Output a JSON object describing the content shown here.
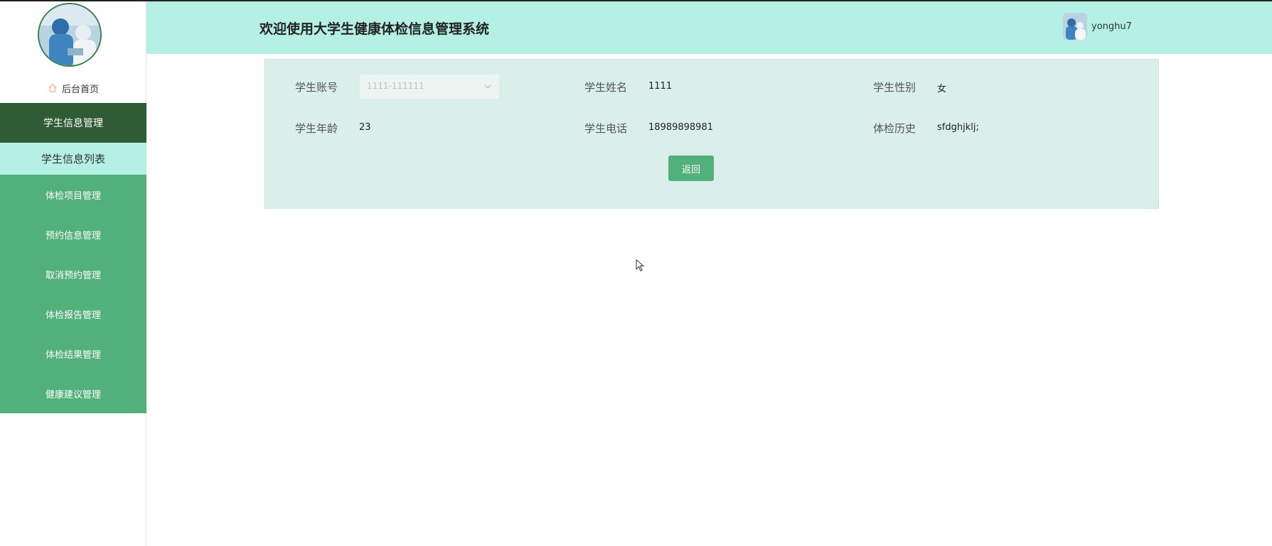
{
  "header": {
    "title": "欢迎使用大学生健康体检信息管理系统",
    "username": "yonghu7"
  },
  "sidebar": {
    "home_label": "后台首页",
    "group_label": "学生信息管理",
    "sub_label": "学生信息列表",
    "items": [
      {
        "label": "体检项目管理"
      },
      {
        "label": "预约信息管理"
      },
      {
        "label": "取消预约管理"
      },
      {
        "label": "体检报告管理"
      },
      {
        "label": "体检结果管理"
      },
      {
        "label": "健康建议管理"
      }
    ]
  },
  "form": {
    "account_label": "学生账号",
    "account_value": "1111-111111",
    "name_label": "学生姓名",
    "name_value": "1111",
    "gender_label": "学生性别",
    "gender_value": "女",
    "age_label": "学生年龄",
    "age_value": "23",
    "phone_label": "学生电话",
    "phone_value": "18989898981",
    "history_label": "体检历史",
    "history_value": "sfdghjklj;",
    "back_button": "返回"
  },
  "colors": {
    "header_bg": "#b4f0e4",
    "menu_active_group": "#2f5b35",
    "menu_bg": "#52b07a",
    "panel_bg": "#daeeea",
    "button_bg": "#52b07a"
  },
  "icons": {
    "home": "home-icon",
    "select_arrow": "chevron-down-icon",
    "cursor": "mouse-pointer-icon"
  }
}
